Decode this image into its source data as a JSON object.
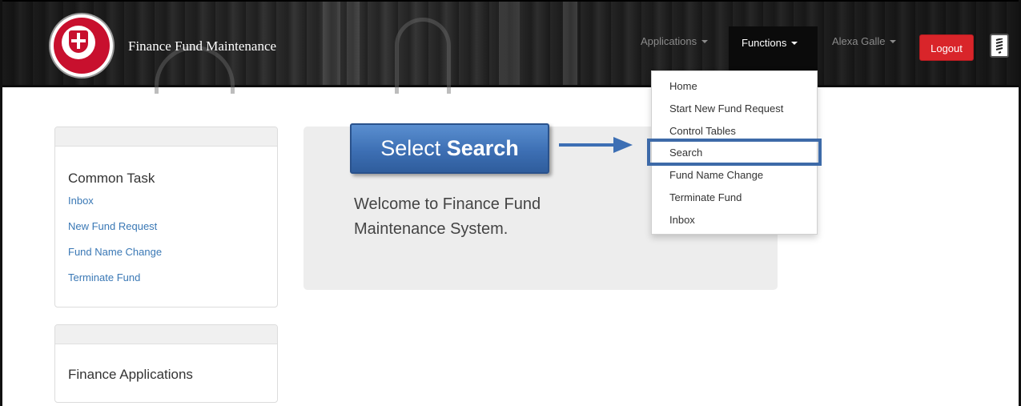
{
  "header": {
    "app_title": "Finance Fund Maintenance",
    "nav": {
      "applications_label": "Applications",
      "functions_label": "Functions",
      "user_label": "Alexa Galle",
      "logout_label": "Logout"
    }
  },
  "functions_menu": {
    "items": [
      "Home",
      "Start New Fund Request",
      "Control Tables",
      "Search",
      "Fund Name Change",
      "Terminate Fund",
      "Inbox"
    ],
    "highlighted_item": "Search"
  },
  "callout": {
    "prefix": "Select ",
    "emphasis": "Search"
  },
  "common_task_panel": {
    "title": "Common Task",
    "links": [
      "Inbox",
      "New Fund Request",
      "Fund Name Change",
      "Terminate Fund"
    ]
  },
  "finance_apps_panel": {
    "title": "Finance Applications"
  },
  "welcome": {
    "text": "Welcome to Finance Fund Maintenance System."
  },
  "colors": {
    "brand_red": "#c8102e",
    "logout_red": "#d9252a",
    "link_blue": "#3a78b5",
    "callout_blue": "#3d6fb4",
    "highlight_blue": "#3d6aa8"
  },
  "icons": {
    "logo": "university-seal-icon",
    "menu_toggle": "menu-toggle-icon",
    "caret": "caret-down-icon",
    "arrow": "arrow-right-icon"
  }
}
